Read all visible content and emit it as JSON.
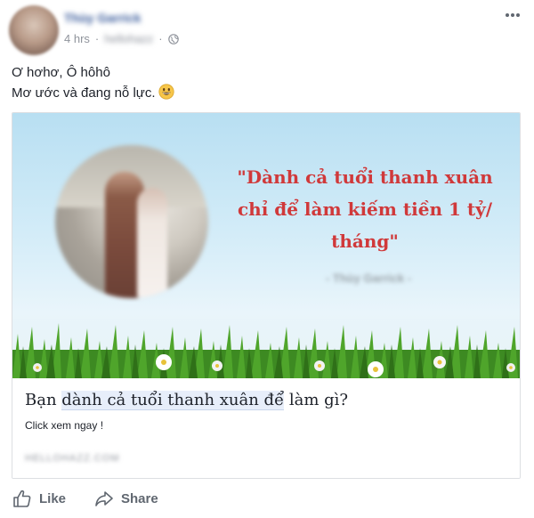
{
  "post": {
    "author": "Thùy Garrick",
    "time": "4 hrs",
    "source": "hellohazz",
    "more_icon": "more-horizontal-icon",
    "globe_icon": "globe-icon",
    "text_line1": "Ơ hơhơ, Ô hôhô",
    "text_line2": "Mơ ước và đang nỗ lực.",
    "emoji_icon": "grinning-smiley-icon"
  },
  "card": {
    "quote": "\"Dành cả tuổi thanh xuân chỉ để làm kiếm tiền 1 tỷ/ tháng\"",
    "quote_author": "- Thùy Garrick -",
    "title_part1": "Bạn ",
    "title_highlight": "dành cả tuổi thanh xuân để",
    "title_part2": " làm gì?",
    "description": "Click xem ngay !",
    "domain": "HELLOHAZZ.COM"
  },
  "actions": {
    "like_label": "Like",
    "share_label": "Share",
    "like_icon": "thumbs-up-icon",
    "share_icon": "share-arrow-icon"
  },
  "colors": {
    "author_link": "#365899",
    "quote_red": "#d0393a",
    "action_gray": "#606770",
    "meta_gray": "#90949c"
  }
}
